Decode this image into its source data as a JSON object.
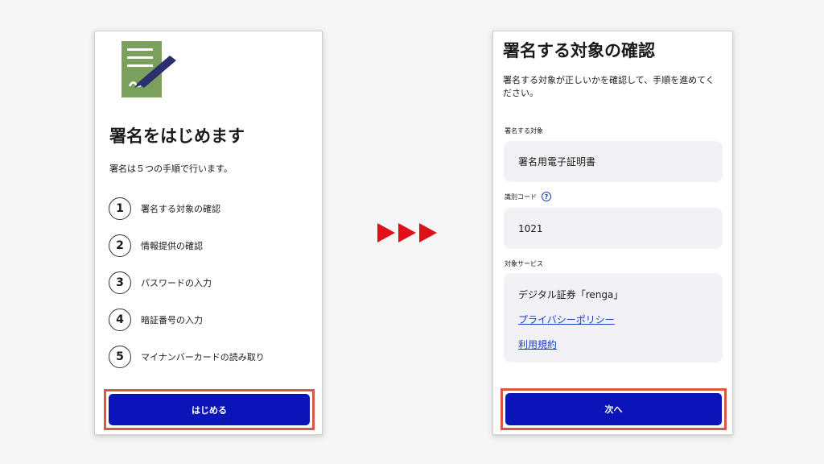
{
  "left_screen": {
    "title": "署名をはじめます",
    "subtitle": "署名は５つの手順で行います。",
    "steps": [
      {
        "num": "1",
        "label": "署名する対象の確認"
      },
      {
        "num": "2",
        "label": "情報提供の確認"
      },
      {
        "num": "3",
        "label": "パスワードの入力"
      },
      {
        "num": "4",
        "label": "暗証番号の入力"
      },
      {
        "num": "5",
        "label": "マイナンバーカードの読み取り"
      }
    ],
    "start_button": "はじめる",
    "icon": "document-signing-icon"
  },
  "right_screen": {
    "title": "署名する対象の確認",
    "description": "署名する対象が正しいかを確認して、手順を進めてください。",
    "target_label": "署名する対象",
    "target_value": "署名用電子証明書",
    "code_label": "識別コード",
    "code_help": "?",
    "code_value": "1021",
    "service_label": "対象サービス",
    "service_name": "デジタル証券「renga」",
    "privacy_link": "プライバシーポリシー",
    "terms_link": "利用規約",
    "next_button": "次へ"
  },
  "colors": {
    "primary": "#0a14b8",
    "highlight": "#d9593e",
    "arrow": "#e0101a",
    "doc_icon": "#7ba05b",
    "link": "#1a3fbf"
  }
}
